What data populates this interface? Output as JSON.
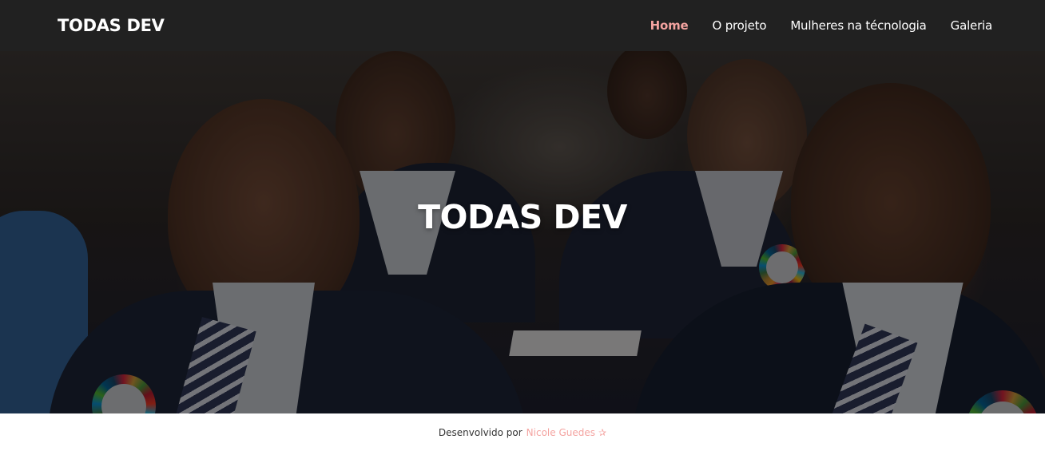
{
  "navbar": {
    "brand": "TODAS DEV",
    "links": [
      {
        "label": "Home",
        "active": true
      },
      {
        "label": "O projeto",
        "active": false
      },
      {
        "label": "Mulheres na técnologia",
        "active": false
      },
      {
        "label": "Galeria",
        "active": false
      }
    ]
  },
  "hero": {
    "title": "TODAS DEV",
    "image": "photo of schoolgirls in navy blazers and striped ties"
  },
  "footer": {
    "prefix": "Desenvolvido por",
    "author": "Nicole Guedes",
    "star": "✰"
  },
  "colors": {
    "navbar_bg": "#212121",
    "accent": "#f4a3a0",
    "nav_text": "#ffffff",
    "footer_text": "#333333"
  }
}
